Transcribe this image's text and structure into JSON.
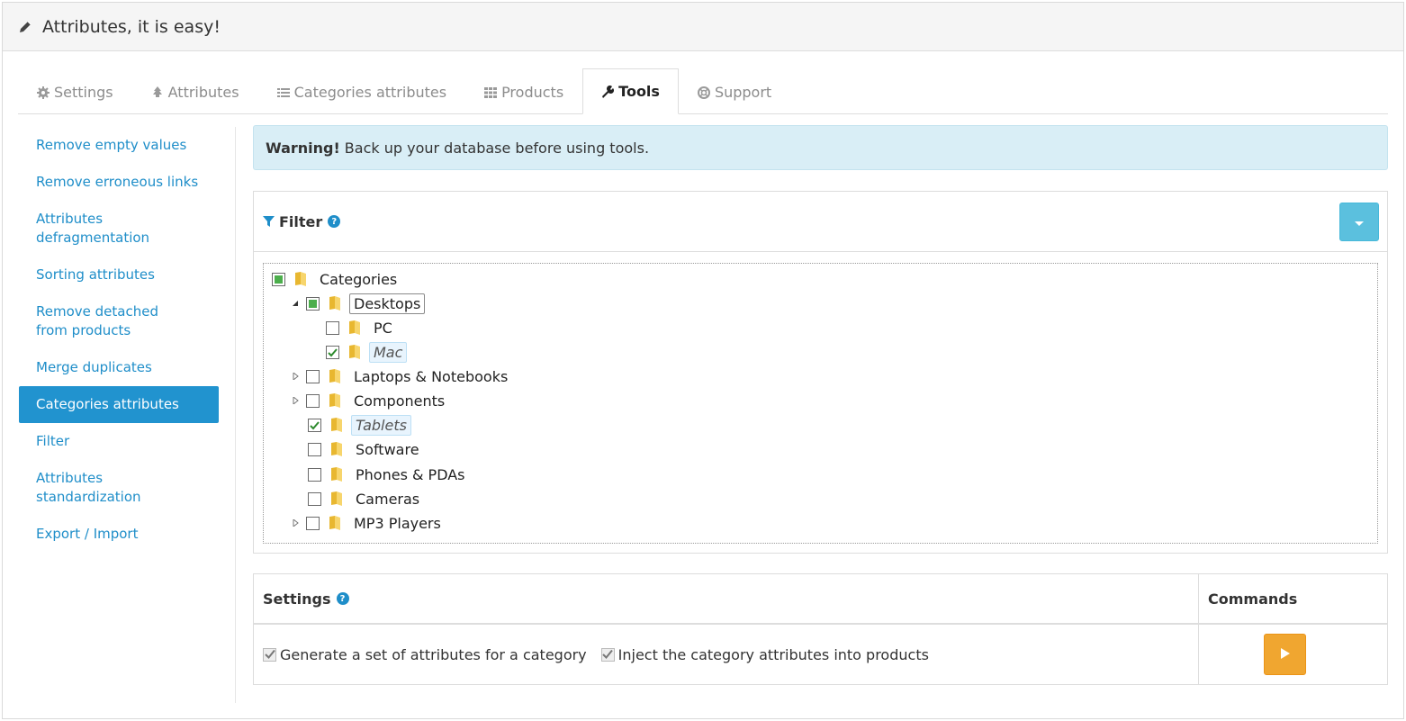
{
  "header": {
    "title": "Attributes, it is easy!",
    "icon": "pencil-icon"
  },
  "tabs": [
    {
      "label": "Settings",
      "icon": "gear-icon",
      "active": false
    },
    {
      "label": "Attributes",
      "icon": "tree-icon",
      "active": false
    },
    {
      "label": "Categories attributes",
      "icon": "list-icon",
      "active": false
    },
    {
      "label": "Products",
      "icon": "grid-icon",
      "active": false
    },
    {
      "label": "Tools",
      "icon": "wrench-icon",
      "active": true
    },
    {
      "label": "Support",
      "icon": "lifebuoy-icon",
      "active": false
    }
  ],
  "sidebar": {
    "items": [
      {
        "label": "Remove empty values"
      },
      {
        "label": "Remove erroneous links"
      },
      {
        "label": "Attributes defragmentation"
      },
      {
        "label": "Sorting attributes"
      },
      {
        "label": "Remove detached from products"
      },
      {
        "label": "Merge duplicates"
      },
      {
        "label": "Categories attributes",
        "active": true
      },
      {
        "label": "Filter"
      },
      {
        "label": "Attributes standardization"
      },
      {
        "label": "Export / Import"
      }
    ]
  },
  "alert": {
    "strong": "Warning!",
    "text": "Back up your database before using tools."
  },
  "filter": {
    "title": "Filter",
    "help": "?",
    "tree": [
      {
        "label": "Categories",
        "state": "partial",
        "expander": "none"
      },
      {
        "label": "Desktops",
        "state": "partial",
        "expander": "expanded"
      },
      {
        "label": "PC",
        "state": "unchecked",
        "expander": "none"
      },
      {
        "label": "Mac",
        "state": "checked",
        "expander": "none"
      },
      {
        "label": "Laptops & Notebooks",
        "state": "unchecked",
        "expander": "collapsed"
      },
      {
        "label": "Components",
        "state": "unchecked",
        "expander": "collapsed"
      },
      {
        "label": "Tablets",
        "state": "checked",
        "expander": "none"
      },
      {
        "label": "Software",
        "state": "unchecked",
        "expander": "none"
      },
      {
        "label": "Phones & PDAs",
        "state": "unchecked",
        "expander": "none"
      },
      {
        "label": "Cameras",
        "state": "unchecked",
        "expander": "none"
      },
      {
        "label": "MP3 Players",
        "state": "unchecked",
        "expander": "collapsed"
      }
    ]
  },
  "settings": {
    "title": "Settings",
    "help": "?",
    "commands_title": "Commands",
    "options": [
      {
        "label": "Generate a set of attributes for a category",
        "checked": true
      },
      {
        "label": "Inject the category attributes into products",
        "checked": true
      }
    ],
    "run_icon": "play-icon"
  },
  "colors": {
    "accent": "#2193cf",
    "alert_bg": "#d9eef6",
    "dropdown_btn": "#5bc0de",
    "run_btn": "#f0a630",
    "tree_partial": "#4cae4c"
  }
}
